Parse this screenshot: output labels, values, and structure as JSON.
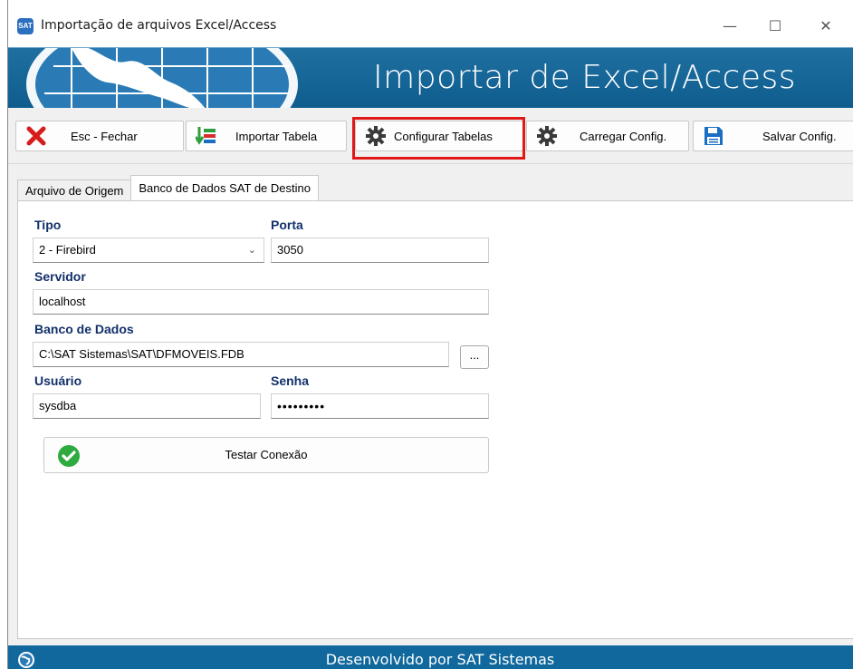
{
  "window": {
    "title": "Importação de arquivos Excel/Access",
    "app_icon_text": "SAT",
    "minimize_glyph": "—",
    "maximize_glyph": "☐",
    "close_glyph": "✕"
  },
  "banner": {
    "title": "Importar de Excel/Access"
  },
  "toolbar": {
    "buttons": [
      {
        "label": "Esc - Fechar",
        "icon": "close-x-icon",
        "color": "#d71c1c"
      },
      {
        "label": "Importar Tabela",
        "icon": "import-table-icon",
        "color": "#2e9e3e"
      },
      {
        "label": "Configurar Tabelas",
        "icon": "gear-icon",
        "color": "#333333"
      },
      {
        "label": "Carregar Config.",
        "icon": "gear-icon",
        "color": "#333333"
      },
      {
        "label": "Salvar Config.",
        "icon": "floppy-disk-icon",
        "color": "#1a6fc2"
      }
    ],
    "highlight_color": "#e01818"
  },
  "tabs": [
    {
      "label": "Arquivo de Origem",
      "active": false
    },
    {
      "label": "Banco de Dados SAT de Destino",
      "active": true
    }
  ],
  "form": {
    "tipo_label": "Tipo",
    "tipo_value": "2 - Firebird",
    "porta_label": "Porta",
    "porta_value": "3050",
    "servidor_label": "Servidor",
    "servidor_value": "localhost",
    "banco_label": "Banco de Dados",
    "banco_value": "C:\\SAT Sistemas\\SAT\\DFMOVEIS.FDB",
    "browse_label": "...",
    "usuario_label": "Usuário",
    "usuario_value": "sysdba",
    "senha_label": "Senha",
    "senha_value": "•••••••••",
    "test_label": "Testar Conexão",
    "label_color": "#12306b"
  },
  "statusbar": {
    "text": "Desenvolvido por SAT Sistemas",
    "color": "#11689d"
  }
}
